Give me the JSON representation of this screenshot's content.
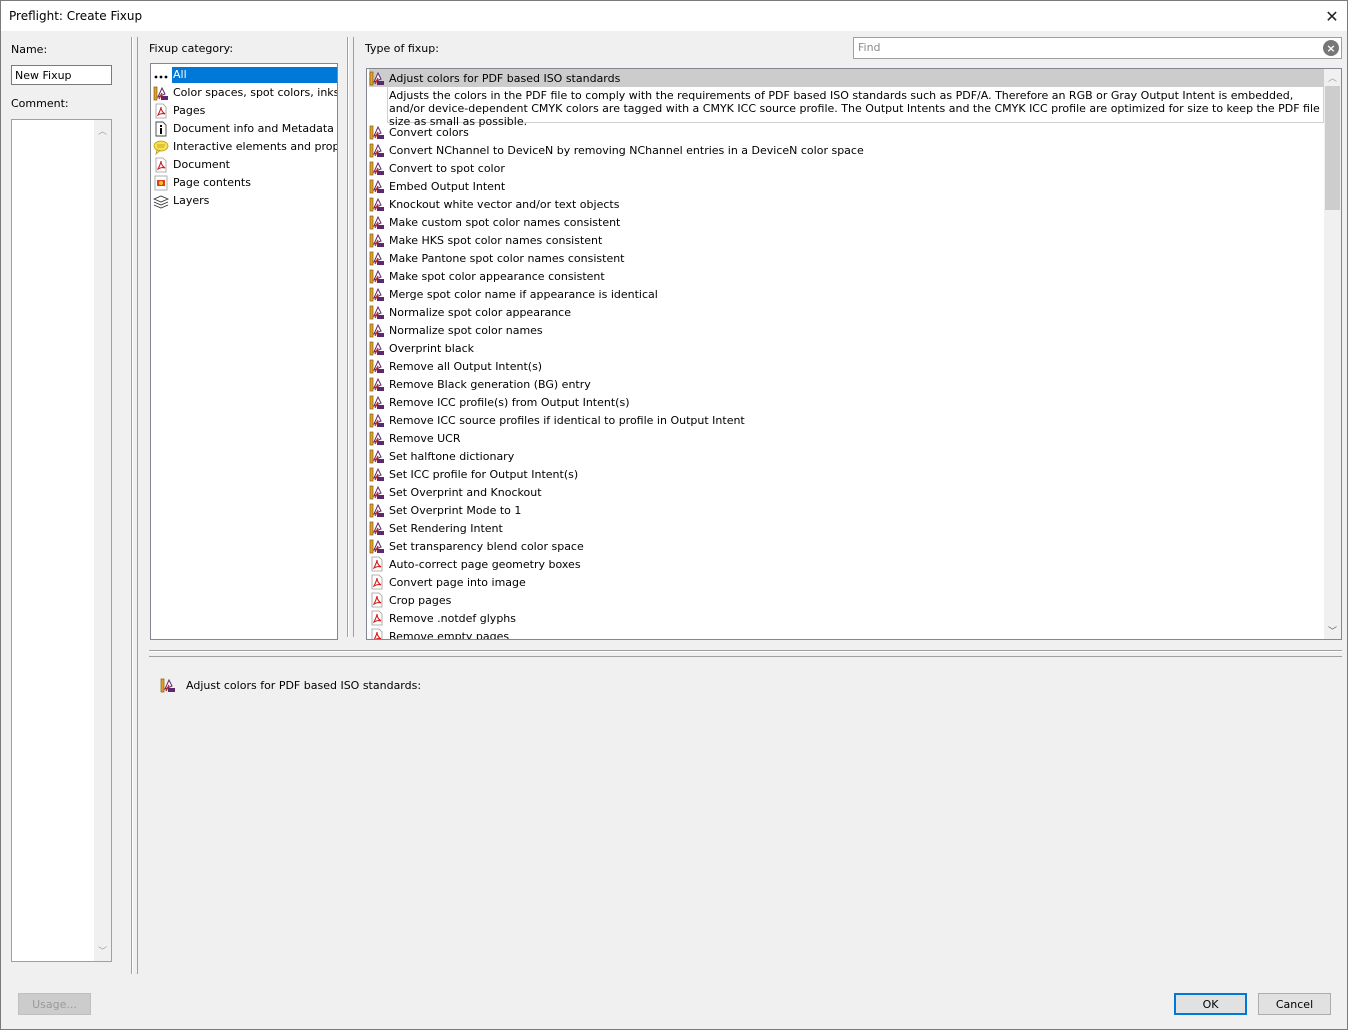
{
  "window": {
    "title": "Preflight: Create Fixup",
    "close_glyph": "✕"
  },
  "left": {
    "name_label": "Name:",
    "name_value": "New Fixup",
    "comment_label": "Comment:",
    "comment_value": ""
  },
  "categories": {
    "label": "Fixup category:",
    "items": [
      {
        "label": "All",
        "icon": "ellipsis-icon",
        "selected": true
      },
      {
        "label": "Color spaces, spot colors, inks",
        "icon": "color-fixup-icon"
      },
      {
        "label": "Pages",
        "icon": "pdf-icon"
      },
      {
        "label": "Document info and Metadata",
        "icon": "info-icon"
      },
      {
        "label": "Interactive elements and properties",
        "icon": "comment-icon"
      },
      {
        "label": "Document",
        "icon": "pdf-icon"
      },
      {
        "label": "Page contents",
        "icon": "page-contents-icon"
      },
      {
        "label": "Layers",
        "icon": "layers-icon"
      }
    ]
  },
  "fixups": {
    "label": "Type of fixup:",
    "find_placeholder": "Find",
    "selected_description": "Adjusts the colors in the PDF file to comply with the requirements of PDF based ISO standards such as PDF/A. Therefore an RGB or Gray Output Intent is embedded, and/or device-dependent CMYK colors are tagged with a CMYK ICC source profile. The Output Intents and the CMYK ICC profile are optimized for size to keep the PDF file size as small as possible.",
    "items": [
      {
        "label": "Adjust colors for PDF based ISO standards",
        "icon": "color",
        "selected": true
      },
      {
        "label": "Convert colors",
        "icon": "color"
      },
      {
        "label": "Convert NChannel to DeviceN by removing NChannel entries in a DeviceN color space",
        "icon": "color"
      },
      {
        "label": "Convert to spot color",
        "icon": "color"
      },
      {
        "label": "Embed Output Intent",
        "icon": "color"
      },
      {
        "label": "Knockout white vector and/or text objects",
        "icon": "color"
      },
      {
        "label": "Make custom spot color names consistent",
        "icon": "color"
      },
      {
        "label": "Make HKS spot color names consistent",
        "icon": "color"
      },
      {
        "label": "Make Pantone spot color names consistent",
        "icon": "color"
      },
      {
        "label": "Make spot color appearance consistent",
        "icon": "color"
      },
      {
        "label": "Merge spot color name if appearance is identical",
        "icon": "color"
      },
      {
        "label": "Normalize spot color appearance",
        "icon": "color"
      },
      {
        "label": "Normalize spot color names",
        "icon": "color"
      },
      {
        "label": "Overprint black",
        "icon": "color"
      },
      {
        "label": "Remove all Output Intent(s)",
        "icon": "color"
      },
      {
        "label": "Remove Black generation (BG) entry",
        "icon": "color"
      },
      {
        "label": "Remove ICC profile(s) from Output Intent(s)",
        "icon": "color"
      },
      {
        "label": "Remove ICC source profiles if identical to profile in Output Intent",
        "icon": "color"
      },
      {
        "label": "Remove UCR",
        "icon": "color"
      },
      {
        "label": "Set halftone dictionary",
        "icon": "color"
      },
      {
        "label": "Set ICC profile for Output Intent(s)",
        "icon": "color"
      },
      {
        "label": "Set Overprint and Knockout",
        "icon": "color"
      },
      {
        "label": "Set Overprint Mode to 1",
        "icon": "color"
      },
      {
        "label": "Set Rendering Intent",
        "icon": "color"
      },
      {
        "label": "Set transparency blend color space",
        "icon": "color"
      },
      {
        "label": "Auto-correct page geometry boxes",
        "icon": "pdf"
      },
      {
        "label": "Convert page into image",
        "icon": "pdf"
      },
      {
        "label": "Crop pages",
        "icon": "pdf"
      },
      {
        "label": "Remove .notdef glyphs",
        "icon": "pdf"
      },
      {
        "label": "Remove empty pages",
        "icon": "pdf"
      }
    ]
  },
  "detail": {
    "title": "Adjust colors for PDF based ISO standards:"
  },
  "buttons": {
    "usage": "Usage...",
    "ok": "OK",
    "cancel": "Cancel"
  },
  "colors": {
    "selection": "#0078d7",
    "selected_row": "#cccccc",
    "default_button_border": "#0078d7"
  }
}
